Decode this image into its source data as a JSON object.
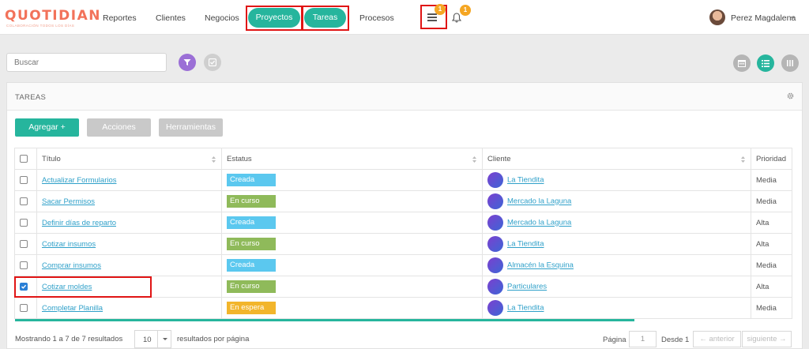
{
  "brand": {
    "logo": "QUOTIDIAN",
    "tagline": "COLABORACIÓN TODOS LOS DÍAS"
  },
  "nav": {
    "reportes": "Reportes",
    "clientes": "Clientes",
    "negocios": "Negocios",
    "proyectos": "Proyectos",
    "tareas": "Tareas",
    "procesos": "Procesos"
  },
  "badges": {
    "list": "1",
    "bell": "1"
  },
  "user": {
    "name": "Perez Magdalena"
  },
  "search": {
    "placeholder": "Buscar"
  },
  "panel": {
    "title": "TAREAS"
  },
  "buttons": {
    "agregar": "Agregar +",
    "acciones": "Acciones",
    "herramientas": "Herramientas"
  },
  "table": {
    "headers": {
      "titulo": "Título",
      "estatus": "Estatus",
      "cliente": "Cliente",
      "prioridad": "Prioridad"
    },
    "rows": [
      {
        "titulo": "Actualizar Formularios",
        "estatus": "Creada",
        "cliente": "La Tiendita",
        "prioridad": "Media",
        "checked": false
      },
      {
        "titulo": "Sacar Permisos",
        "estatus": "En curso",
        "cliente": "Mercado la Laguna",
        "prioridad": "Media",
        "checked": false
      },
      {
        "titulo": "Definir días de reparto",
        "estatus": "Creada",
        "cliente": "Mercado la Laguna",
        "prioridad": "Alta",
        "checked": false
      },
      {
        "titulo": "Cotizar insumos",
        "estatus": "En curso",
        "cliente": "La Tiendita",
        "prioridad": "Alta",
        "checked": false
      },
      {
        "titulo": "Comprar insumos",
        "estatus": "Creada",
        "cliente": "Almacén la Esquina",
        "prioridad": "Media",
        "checked": false
      },
      {
        "titulo": "Cotizar moldes",
        "estatus": "En curso",
        "cliente": "Particulares",
        "prioridad": "Alta",
        "checked": true
      },
      {
        "titulo": "Completar Planilla",
        "estatus": "En espera",
        "cliente": "La Tiendita",
        "prioridad": "Media",
        "checked": false
      }
    ]
  },
  "status_colors": {
    "Creada": "#5bc8ef",
    "En curso": "#8fba5a",
    "En espera": "#f2b52b"
  },
  "colors": {
    "accent": "#26b59d",
    "highlight": "#e01515",
    "filter": "#9b6fd6",
    "link": "#2fa0c9"
  },
  "footer": {
    "mostrando": "Mostrando 1 a 7 de 7 resultados",
    "per_page": "10",
    "per_page_label": "resultados por página",
    "pagina_label": "Página",
    "page_value": "1",
    "desde_label": "Desde",
    "desde_value": "1",
    "anterior": "← anterior",
    "siguiente": "siguiente →"
  }
}
